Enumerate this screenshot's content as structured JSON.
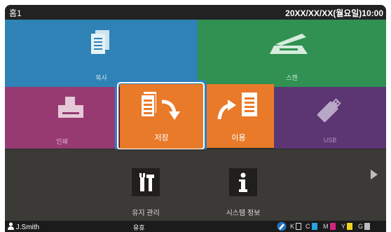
{
  "topbar": {
    "title": "홈1",
    "datetime": "20XX/XX/XX(월요일)10:00"
  },
  "tiles": {
    "copy": "복사",
    "scan": "스캔",
    "print": "인쇄",
    "store": "저장",
    "use": "이용",
    "usb": "USB"
  },
  "lower": {
    "maintenance": "유지 관리",
    "system_info": "시스템 정보"
  },
  "status": {
    "user": "J.Smith",
    "state": "유휴",
    "inks": [
      "K",
      "C",
      "M",
      "Y",
      "G"
    ]
  },
  "colors": {
    "copy": "#2e82b5",
    "scan": "#309152",
    "print": "#983a72",
    "store": "#e97a2a",
    "usb": "#5c3573",
    "highlight": "#2f7fc0",
    "ink_k": "#ffffff",
    "ink_c": "#29a3dd",
    "ink_m": "#d6257e",
    "ink_y": "#f2d21b",
    "ink_g": "#bdbdbd"
  },
  "icons": [
    "document-icon",
    "scanner-icon",
    "printer-icon",
    "store-document-icon",
    "use-document-icon",
    "usb-icon",
    "tools-icon",
    "info-icon",
    "user-icon",
    "next-page-arrow-icon",
    "ink-status-icon"
  ]
}
